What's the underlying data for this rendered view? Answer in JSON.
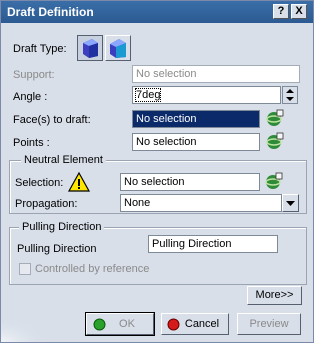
{
  "window": {
    "title": "Draft Definition",
    "help_label": "?",
    "close_label": "X"
  },
  "draft_type": {
    "label": "Draft Type:"
  },
  "support": {
    "label": "Support:",
    "value": "No selection"
  },
  "angle": {
    "label": "Angle :",
    "value": "7deg"
  },
  "faces": {
    "label": "Face(s) to draft:",
    "value": "No selection"
  },
  "points": {
    "label": "Points :",
    "value": "No selection"
  },
  "neutral": {
    "title": "Neutral Element",
    "selection_label": "Selection:",
    "selection_value": "No selection",
    "propagation_label": "Propagation:",
    "propagation_value": "None"
  },
  "pulling": {
    "title": "Pulling Direction",
    "label": "Pulling Direction",
    "value": "Pulling Direction",
    "controlled_label": "Controlled by reference"
  },
  "buttons": {
    "more": "More>>",
    "ok": "OK",
    "cancel": "Cancel",
    "preview": "Preview"
  }
}
